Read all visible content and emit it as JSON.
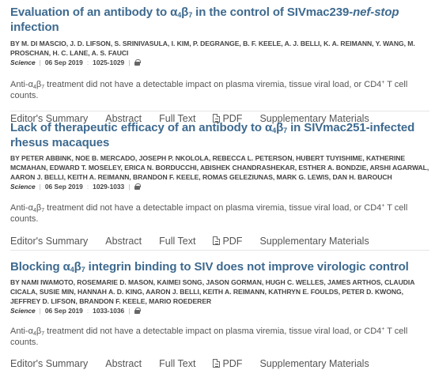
{
  "articles": [
    {
      "title_pre": "Evaluation of an antibody to α",
      "title_sub1": "4",
      "title_mid": "β",
      "title_sub2": "7",
      "title_post": " in the control of SIVmac239-",
      "title_italic": "nef-stop",
      "title_end": " infection",
      "authors": "By M. Di Mascio, J. D. Lifson, S. Srinivasula, I. Kim, P. DeGrange, B. F. Keele, A. J. Belli, K. A. Reimann, Y. Wang, M. Proschan, H. C. Lane, A. S. Fauci",
      "journal": "Science",
      "date": "06 Sep 2019",
      "pages": "1025-1029",
      "summary_pre": "Anti-α",
      "summary_sub1": "4",
      "summary_mid": "β",
      "summary_sub2": "7",
      "summary_post": " treatment did not have a detectable impact on plasma viremia, tissue viral load, or CD4",
      "summary_sup": "+",
      "summary_end": " T cell counts.",
      "links": {
        "editors_summary": "Editor's Summary",
        "abstract": "Abstract",
        "full_text": "Full Text",
        "pdf": "PDF",
        "supplementary": "Supplementary Materials"
      }
    },
    {
      "title_pre": "Lack of therapeutic efficacy of an antibody to α",
      "title_sub1": "4",
      "title_mid": "β",
      "title_sub2": "7",
      "title_post": " in SIVmac251-infected rhesus macaques",
      "authors": "By Peter Abbink, Noe B. Mercado, Joseph P. Nkolola, Rebecca L. Peterson, Hubert Tuyishime, Katherine McMahan, Edward T. Moseley, Erica N. Borducchi, Abishek Chandrashekar, Esther A. Bondzie, Arshi Agarwal, Aaron J. Belli, Keith A. Reimann, Brandon F. Keele, Romas Geleziunas, Mark G. Lewis, Dan H. Barouch",
      "journal": "Science",
      "date": "06 Sep 2019",
      "pages": "1029-1033",
      "summary_pre": "Anti-α",
      "summary_sub1": "4",
      "summary_mid": "β",
      "summary_sub2": "7",
      "summary_post": " treatment did not have a detectable impact on plasma viremia, tissue viral load, or CD4",
      "summary_sup": "+",
      "summary_end": " T cell counts.",
      "links": {
        "editors_summary": "Editor's Summary",
        "abstract": "Abstract",
        "full_text": "Full Text",
        "pdf": "PDF",
        "supplementary": "Supplementary Materials"
      }
    },
    {
      "title_pre": "Blocking α",
      "title_sub1": "4",
      "title_mid": "β",
      "title_sub2": "7",
      "title_post": " integrin binding to SIV does not improve virologic control",
      "authors": "By Nami Iwamoto, Rosemarie D. Mason, Kaimei Song, Jason Gorman, Hugh C. Welles, James Arthos, Claudia Cicala, Susie Min, Hannah A. D. King, Aaron J. Belli, Keith A. Reimann, Kathryn E. Foulds, Peter D. Kwong, Jeffrey D. Lifson, Brandon F. Keele, Mario Roederer",
      "journal": "Science",
      "date": "06 Sep 2019",
      "pages": "1033-1036",
      "summary_pre": "Anti-α",
      "summary_sub1": "4",
      "summary_mid": "β",
      "summary_sub2": "7",
      "summary_post": " treatment did not have a detectable impact on plasma viremia, tissue viral load, or CD4",
      "summary_sup": "+",
      "summary_end": " T cell counts.",
      "links": {
        "editors_summary": "Editor's Summary",
        "abstract": "Abstract",
        "full_text": "Full Text",
        "pdf": "PDF",
        "supplementary": "Supplementary Materials"
      }
    }
  ],
  "colors": {
    "title": "#3e6a8f",
    "text": "#555555"
  },
  "icons": {
    "lock": "lock-icon",
    "pdf": "pdf-file-icon"
  }
}
